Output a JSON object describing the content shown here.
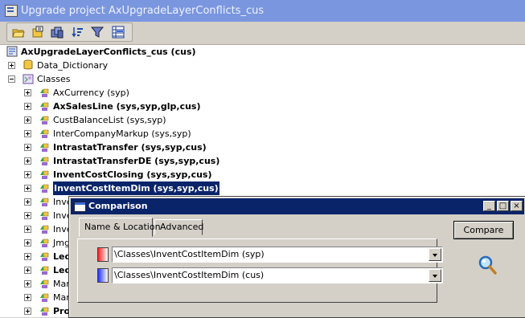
{
  "window": {
    "title": "Upgrade project AxUpgradeLayerConflicts_cus"
  },
  "toolbar": {
    "buttons": [
      "open-folder-icon",
      "properties-icon",
      "copy-icon",
      "sort-icon",
      "filter-icon",
      "compare-grid-icon"
    ]
  },
  "tree": {
    "root": "AxUpgradeLayerConflicts_cus (cus)",
    "data_dictionary": "Data_Dictionary",
    "classes": "Classes",
    "items": [
      {
        "label": "AxCurrency (syp)",
        "bold": false
      },
      {
        "label": "AxSalesLine (sys,syp,glp,cus)",
        "bold": true
      },
      {
        "label": "CustBalanceList (sys,syp)",
        "bold": false
      },
      {
        "label": "InterCompanyMarkup (sys,syp)",
        "bold": false
      },
      {
        "label": "IntrastatTransfer (sys,syp,cus)",
        "bold": true
      },
      {
        "label": "IntrastatTransferDE (sys,syp,cus)",
        "bold": true
      },
      {
        "label": "InventCostClosing (sys,syp,cus)",
        "bold": true
      },
      {
        "label": "InventCostItemDim (sys,syp,cus)",
        "bold": true,
        "selected": true
      },
      {
        "label": "Inve",
        "bold": false
      },
      {
        "label": "Inve",
        "bold": false
      },
      {
        "label": "Inve",
        "bold": false
      },
      {
        "label": "Jmg",
        "bold": false
      },
      {
        "label": "Led",
        "bold": true
      },
      {
        "label": "Led",
        "bold": true
      },
      {
        "label": "Mar",
        "bold": false
      },
      {
        "label": "Mar",
        "bold": false
      },
      {
        "label": "Pro",
        "bold": true
      }
    ]
  },
  "dialog": {
    "title": "Comparison",
    "tabs": [
      "Name & Location",
      "Advanced"
    ],
    "active_tab": "Name & Location",
    "rows": [
      {
        "value": "\\Classes\\InventCostItemDim (syp)",
        "color": "#ff2020"
      },
      {
        "value": "\\Classes\\InventCostItemDim (cus)",
        "color": "#2030ff"
      }
    ],
    "compare_button": "Compare",
    "window_buttons": [
      "_",
      "□",
      "×"
    ]
  },
  "colors": {
    "selection": "#0a246a",
    "titlebar": "#7a96df"
  }
}
